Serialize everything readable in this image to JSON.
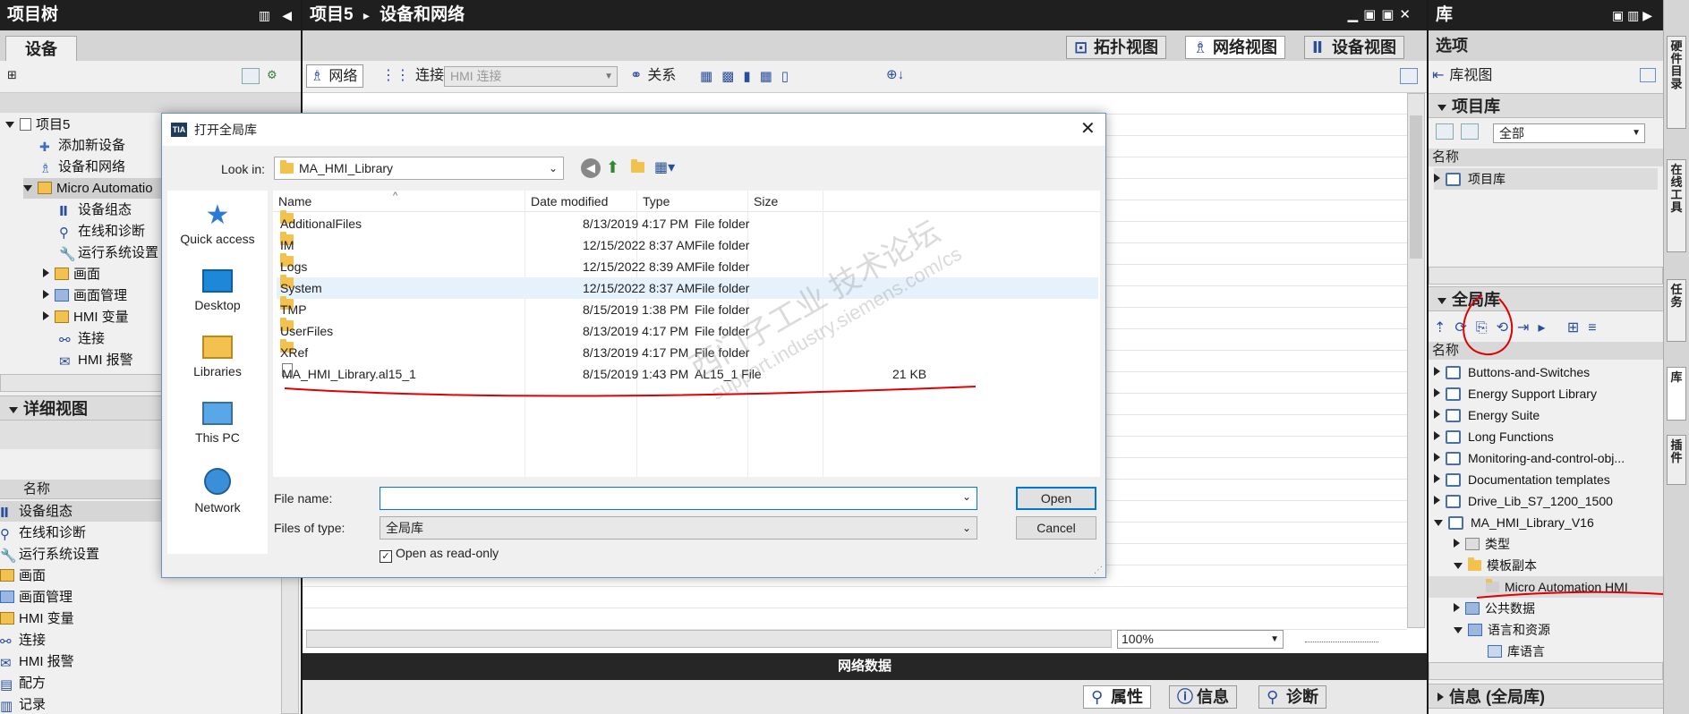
{
  "project_tree": {
    "title": "项目树",
    "tab": "设备",
    "items": [
      {
        "label": "项目5"
      },
      {
        "label": "添加新设备"
      },
      {
        "label": "设备和网络"
      },
      {
        "label": "Micro Automatio"
      },
      {
        "label": "设备组态"
      },
      {
        "label": "在线和诊断"
      },
      {
        "label": "运行系统设置"
      },
      {
        "label": "画面"
      },
      {
        "label": "画面管理"
      },
      {
        "label": "HMI 变量"
      },
      {
        "label": "连接"
      },
      {
        "label": "HMI 报警"
      }
    ],
    "detail_title": "详细视图",
    "detail_col_name": "名称",
    "detail_items": [
      {
        "label": "设备组态"
      },
      {
        "label": "在线和诊断"
      },
      {
        "label": "运行系统设置"
      },
      {
        "label": "画面"
      },
      {
        "label": "画面管理"
      },
      {
        "label": "HMI 变量"
      },
      {
        "label": "连接"
      },
      {
        "label": "HMI 报警"
      },
      {
        "label": "配方"
      },
      {
        "label": "记录"
      }
    ]
  },
  "editor": {
    "breadcrumb_project": "项目5",
    "breadcrumb_sep": "▸",
    "breadcrumb_page": "设备和网络",
    "tabs": [
      {
        "label": "拓扑视图"
      },
      {
        "label": "网络视图"
      },
      {
        "label": "设备视图"
      }
    ],
    "toolbar": {
      "network": "网络",
      "connection": "连接",
      "hmi_connection": "HMI 连接",
      "relation": "关系"
    },
    "zoom": "100%",
    "network_data": "网络数据"
  },
  "bottom_tabs": [
    {
      "label": "属性"
    },
    {
      "label": "信息"
    },
    {
      "label": "诊断"
    }
  ],
  "library": {
    "title": "库",
    "options": "选项",
    "library_view": "库视图",
    "project_library_section": "项目库",
    "filter_value": "全部",
    "col_name": "名称",
    "project_library_item": "项目库",
    "global_library_section": "全局库",
    "items": [
      {
        "label": "Buttons-and-Switches"
      },
      {
        "label": "Energy Support Library"
      },
      {
        "label": "Energy Suite"
      },
      {
        "label": "Long Functions"
      },
      {
        "label": "Monitoring-and-control-obj..."
      },
      {
        "label": "Documentation templates"
      },
      {
        "label": "Drive_Lib_S7_1200_1500"
      },
      {
        "label": "MA_HMI_Library_V16"
      },
      {
        "label": "类型"
      },
      {
        "label": "模板副本"
      },
      {
        "label": "Micro Automation HMI"
      },
      {
        "label": "公共数据"
      },
      {
        "label": "语言和资源"
      },
      {
        "label": "库语言"
      }
    ],
    "info_section": "信息 (全局库)"
  },
  "right_strip": [
    "硬件目录",
    "在线工具",
    "任务",
    "库",
    "插件"
  ],
  "dialog": {
    "title": "打开全局库",
    "look_in_label": "Look in:",
    "look_in_value": "MA_HMI_Library",
    "places": [
      {
        "label": "Quick access"
      },
      {
        "label": "Desktop"
      },
      {
        "label": "Libraries"
      },
      {
        "label": "This PC"
      },
      {
        "label": "Network"
      }
    ],
    "columns": {
      "name": "Name",
      "date": "Date modified",
      "type": "Type",
      "size": "Size"
    },
    "files": [
      {
        "name": "AdditionalFiles",
        "date": "8/13/2019 4:17 PM",
        "type": "File folder",
        "size": ""
      },
      {
        "name": "IM",
        "date": "12/15/2022 8:37 AM",
        "type": "File folder",
        "size": ""
      },
      {
        "name": "Logs",
        "date": "12/15/2022 8:39 AM",
        "type": "File folder",
        "size": ""
      },
      {
        "name": "System",
        "date": "12/15/2022 8:37 AM",
        "type": "File folder",
        "size": ""
      },
      {
        "name": "TMP",
        "date": "8/15/2019 1:38 PM",
        "type": "File folder",
        "size": ""
      },
      {
        "name": "UserFiles",
        "date": "8/13/2019 4:17 PM",
        "type": "File folder",
        "size": ""
      },
      {
        "name": "XRef",
        "date": "8/13/2019 4:17 PM",
        "type": "File folder",
        "size": ""
      },
      {
        "name": "MA_HMI_Library.al15_1",
        "date": "8/15/2019 1:43 PM",
        "type": "AL15_1 File",
        "size": "21 KB"
      }
    ],
    "file_name_label": "File name:",
    "file_name_value": "",
    "files_of_type_label": "Files of type:",
    "files_of_type_value": "全局库",
    "open_button": "Open",
    "cancel_button": "Cancel",
    "readonly_label": "Open as read-only",
    "readonly_checked": true
  },
  "watermark": {
    "line1": "西门子工业 技术论坛",
    "line2": "support.industry.siemens.com/cs"
  },
  "colors": {
    "dark_header": "#1f1f1f",
    "panel": "#f0f0f0",
    "annotation_red": "#e00000",
    "folder": "#f2c14e",
    "accent": "#0078d7"
  }
}
